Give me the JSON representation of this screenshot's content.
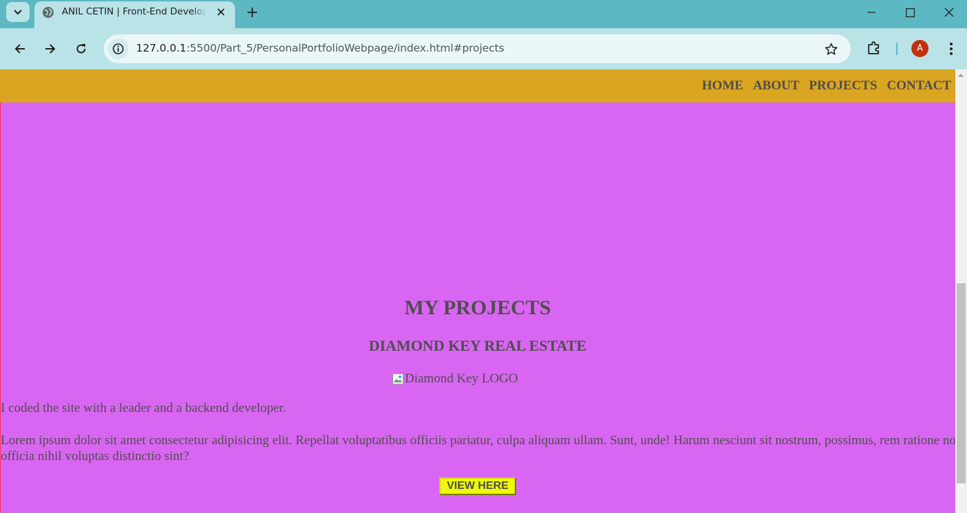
{
  "browser": {
    "tab_title": "ANIL CETIN | Front-End Developer",
    "new_tab_label": "+",
    "url_host": "127.0.0.1",
    "url_path": ":5500/Part_5/PersonalPortfolioWebpage/index.html#projects",
    "profile_initial": "A",
    "icons": [
      "tab-search-icon",
      "globe-icon",
      "close-icon",
      "plus-icon",
      "minimize-icon",
      "maximize-icon",
      "window-close-icon",
      "back-icon",
      "forward-icon",
      "reload-icon",
      "site-info-icon",
      "bookmark-star-icon",
      "extensions-icon",
      "menu-icon"
    ]
  },
  "navbar": {
    "links": [
      "HOME",
      "ABOUT",
      "PROJECTS",
      "CONTACT"
    ],
    "color": "#daa520"
  },
  "projects": {
    "heading": "MY PROJECTS",
    "project_title": "DIAMOND KEY REAL ESTATE",
    "logo_alt": "Diamond Key LOGO",
    "summary": "I coded the site with a leader and a backend developer.",
    "description": "Lorem ipsum dolor sit amet consectetur adipisicing elit. Repellat voluptatibus officiis pariatur, culpa aliquam ullam. Sunt, unde! Harum nesciunt sit nostrum, possimus, rem ratione non officia nihil voluptas distinctio sint?",
    "button_label": "VIEW HERE",
    "background": "#d966f2"
  }
}
